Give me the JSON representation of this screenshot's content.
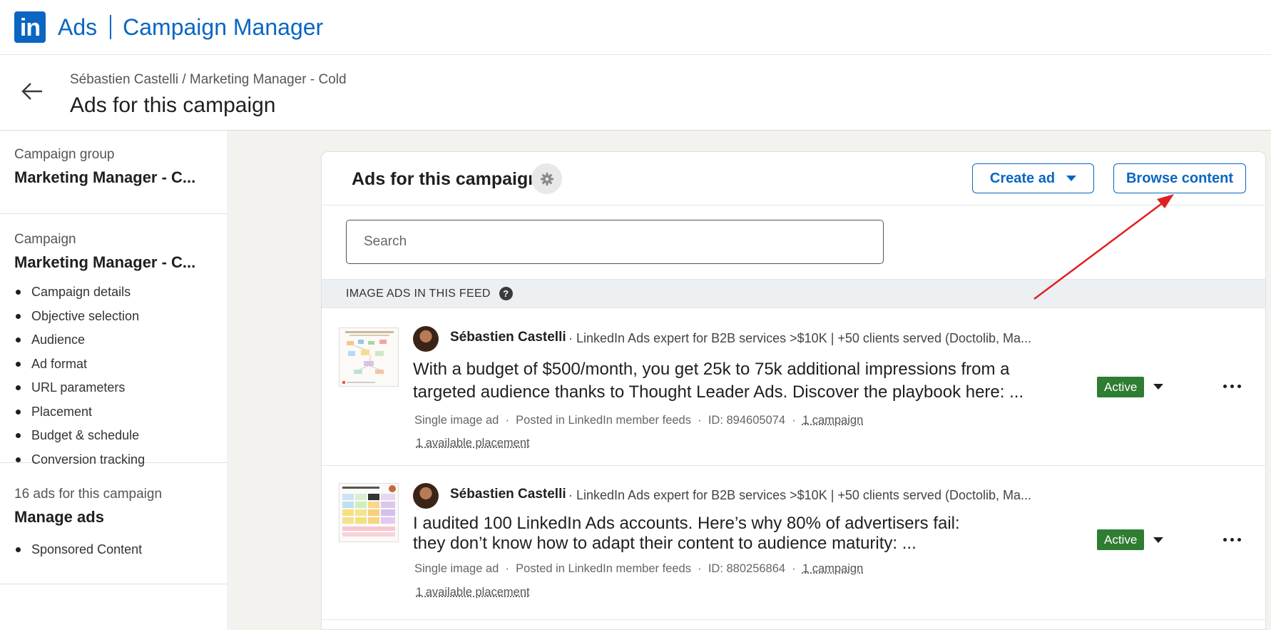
{
  "topbar": {
    "logo_text": "in",
    "brand_ads": "Ads",
    "brand_product": "Campaign Manager",
    "brand_color": "#0a66c2"
  },
  "header": {
    "breadcrumb": "Sébastien Castelli / Marketing Manager - Cold",
    "title": "Ads for this campaign",
    "back_icon": "arrow-left-icon"
  },
  "sidebar": {
    "campaign_group_label": "Campaign group",
    "campaign_group_value": "Marketing Manager - C...",
    "campaign_label": "Campaign",
    "campaign_value": "Marketing Manager - C...",
    "campaign_items": [
      "Campaign details",
      "Objective selection",
      "Audience",
      "Ad format",
      "URL parameters",
      "Placement",
      "Budget & schedule",
      "Conversion tracking"
    ],
    "ads_count_label": "16 ads for this campaign",
    "manage_ads_label": "Manage ads",
    "ads_items": [
      "Sponsored Content"
    ]
  },
  "panel": {
    "title": "Ads for this campaign",
    "settings_icon": "gear-icon",
    "create_ad_label": "Create ad",
    "browse_content_label": "Browse content",
    "search_placeholder": "Search",
    "section_title": "IMAGE ADS IN THIS FEED",
    "help_icon": "question-icon"
  },
  "ads": [
    {
      "author": "Sébastien Castelli",
      "author_headline": "· LinkedIn Ads expert for B2B services >$10K | +50 clients served (Doctolib, Ma...",
      "text_line1": "With a budget of $500/month, you get 25k to 75k additional impressions from a",
      "text_line2": "targeted audience thanks to Thought Leader Ads. Discover the playbook here: ...",
      "format": "Single image ad",
      "posted_in": "Posted in LinkedIn member feeds",
      "id": "ID: 894605074",
      "campaigns": "1 campaign",
      "placement": "1 available placement",
      "status": "Active",
      "status_color": "#2e7d32"
    },
    {
      "author": "Sébastien Castelli",
      "author_headline": "· LinkedIn Ads expert for B2B services >$10K | +50 clients served (Doctolib, Ma...",
      "text_line1": "I audited 100 LinkedIn Ads accounts. Here’s why 80% of advertisers fail:",
      "text_line2": "they don’t know how to adapt their content to audience maturity: ...",
      "format": "Single image ad",
      "posted_in": "Posted in LinkedIn member feeds",
      "id": "ID: 880256864",
      "campaigns": "1 campaign",
      "placement": "1 available placement",
      "status": "Active",
      "status_color": "#2e7d32"
    }
  ],
  "annotation_color": "#e02020"
}
